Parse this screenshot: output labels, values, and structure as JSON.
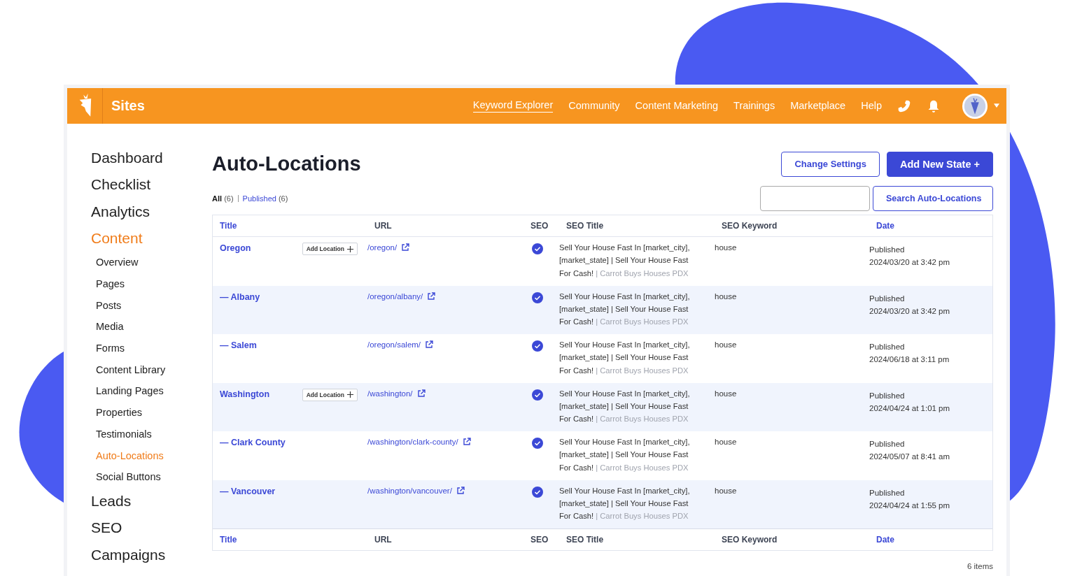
{
  "header": {
    "brand": "Sites",
    "nav": [
      {
        "label": "Keyword Explorer",
        "selected": true
      },
      {
        "label": "Community",
        "selected": false
      },
      {
        "label": "Content Marketing",
        "selected": false
      },
      {
        "label": "Trainings",
        "selected": false
      },
      {
        "label": "Marketplace",
        "selected": false
      },
      {
        "label": "Help",
        "selected": false
      }
    ]
  },
  "sidebar": {
    "items": [
      {
        "label": "Dashboard",
        "kind": "main",
        "selected": false
      },
      {
        "label": "Checklist",
        "kind": "main",
        "selected": false
      },
      {
        "label": "Analytics",
        "kind": "main",
        "selected": false
      },
      {
        "label": "Content",
        "kind": "main",
        "selected": true
      },
      {
        "label": "Overview",
        "kind": "sub",
        "selected": false
      },
      {
        "label": "Pages",
        "kind": "sub",
        "selected": false
      },
      {
        "label": "Posts",
        "kind": "sub",
        "selected": false
      },
      {
        "label": "Media",
        "kind": "sub",
        "selected": false
      },
      {
        "label": "Forms",
        "kind": "sub",
        "selected": false
      },
      {
        "label": "Content Library",
        "kind": "sub",
        "selected": false
      },
      {
        "label": "Landing Pages",
        "kind": "sub",
        "selected": false
      },
      {
        "label": "Properties",
        "kind": "sub",
        "selected": false
      },
      {
        "label": "Testimonials",
        "kind": "sub",
        "selected": false
      },
      {
        "label": "Auto-Locations",
        "kind": "sub",
        "selected": true
      },
      {
        "label": "Social Buttons",
        "kind": "sub",
        "selected": false
      },
      {
        "label": "Leads",
        "kind": "main",
        "selected": false
      },
      {
        "label": "SEO",
        "kind": "main",
        "selected": false
      },
      {
        "label": "Campaigns",
        "kind": "main",
        "selected": false
      }
    ]
  },
  "page": {
    "title": "Auto-Locations",
    "buttons": [
      {
        "label": "Change Settings",
        "kind": "outline"
      },
      {
        "label": "Add New State +",
        "kind": "primary"
      }
    ],
    "filters": [
      {
        "label": "All",
        "count": "(6)",
        "selected": true
      },
      {
        "label": "Published",
        "count": "(6)",
        "selected": false
      }
    ],
    "search_button": "Search Auto-Locations"
  },
  "table": {
    "columns": [
      {
        "label": "Title",
        "sortable": true
      },
      {
        "label": "URL",
        "sortable": false
      },
      {
        "label": "SEO",
        "sortable": false
      },
      {
        "label": "SEO Title",
        "sortable": false
      },
      {
        "label": "SEO Keyword",
        "sortable": false
      },
      {
        "label": "Date",
        "sortable": true
      }
    ],
    "rows": [
      {
        "title": "Oregon",
        "add_location": "Add Location",
        "url": "/oregon/",
        "seo_ok": true,
        "seo_title": "Sell Your House Fast In [market_city], [market_state] | Sell Your House Fast For Cash!",
        "seo_site": "| Carrot Buys Houses PDX",
        "keyword": "house",
        "status": "Published",
        "date": "2024/03/20 at 3:42 pm"
      },
      {
        "title": "— Albany",
        "url": "/oregon/albany/",
        "seo_ok": true,
        "seo_title": "Sell Your House Fast In [market_city], [market_state] | Sell Your House Fast For Cash!",
        "seo_site": "| Carrot Buys Houses PDX",
        "keyword": "house",
        "status": "Published",
        "date": "2024/03/20 at 3:42 pm"
      },
      {
        "title": "— Salem",
        "url": "/oregon/salem/",
        "seo_ok": true,
        "seo_title": "Sell Your House Fast In [market_city], [market_state] | Sell Your House Fast For Cash!",
        "seo_site": "| Carrot Buys Houses PDX",
        "keyword": "house",
        "status": "Published",
        "date": "2024/06/18 at 3:11 pm"
      },
      {
        "title": "Washington",
        "add_location": "Add Location",
        "url": "/washington/",
        "seo_ok": true,
        "seo_title": "Sell Your House Fast In [market_city], [market_state] | Sell Your House Fast For Cash!",
        "seo_site": "| Carrot Buys Houses PDX",
        "keyword": "house",
        "status": "Published",
        "date": "2024/04/24 at 1:01 pm"
      },
      {
        "title": "— Clark County",
        "url": "/washington/clark-county/",
        "seo_ok": true,
        "seo_title": "Sell Your House Fast In [market_city], [market_state] | Sell Your House Fast For Cash!",
        "seo_site": "| Carrot Buys Houses PDX",
        "keyword": "house",
        "status": "Published",
        "date": "2024/05/07 at 8:41 am"
      },
      {
        "title": "— Vancouver",
        "url": "/washington/vancouver/",
        "seo_ok": true,
        "seo_title": "Sell Your House Fast In [market_city], [market_state] | Sell Your House Fast For Cash!",
        "seo_site": "| Carrot Buys Houses PDX",
        "keyword": "house",
        "status": "Published",
        "date": "2024/04/24 at 1:55 pm"
      }
    ],
    "footer_columns": [
      {
        "label": "Title",
        "sortable": true
      },
      {
        "label": "URL",
        "sortable": false
      },
      {
        "label": "SEO",
        "sortable": false
      },
      {
        "label": "SEO Title",
        "sortable": false
      },
      {
        "label": "SEO Keyword",
        "sortable": false
      },
      {
        "label": "Date",
        "sortable": true
      }
    ],
    "item_count": "6 items"
  }
}
